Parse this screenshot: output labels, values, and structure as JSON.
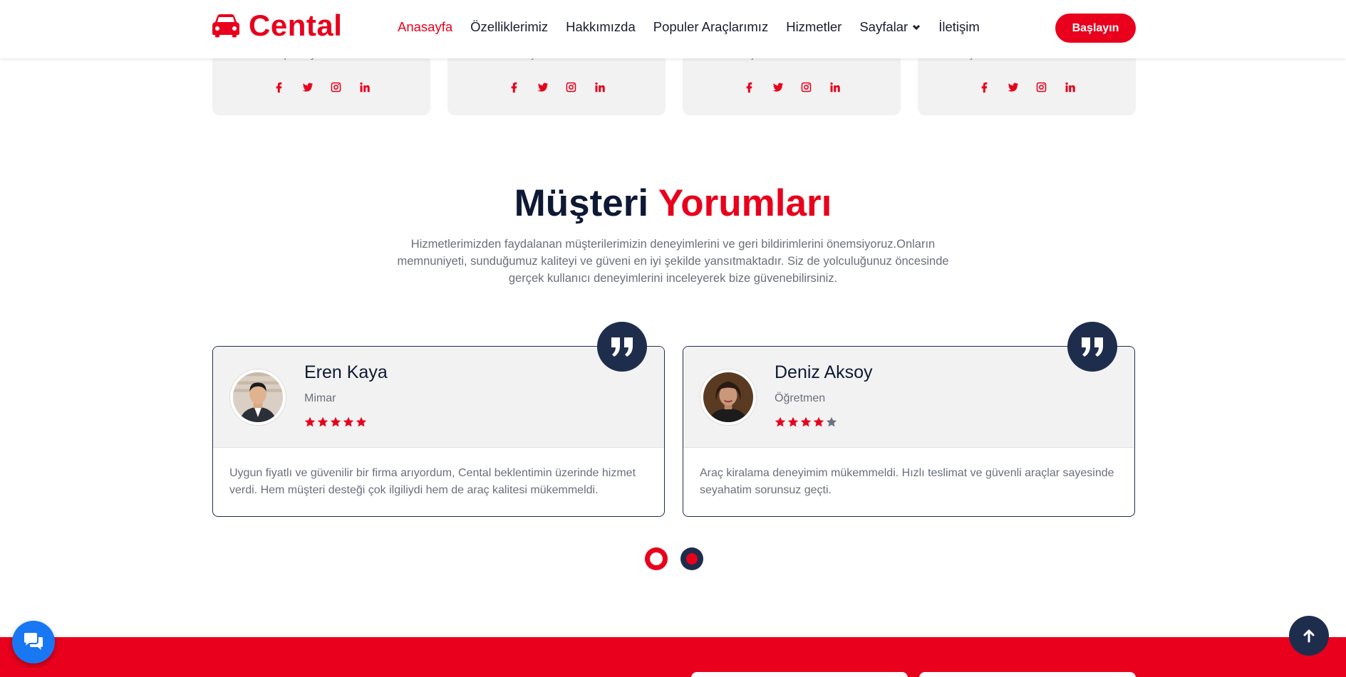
{
  "brand": {
    "name": "Cental",
    "logo_icon": "car-icon"
  },
  "nav": {
    "items": [
      {
        "label": "Anasayfa",
        "active": true
      },
      {
        "label": "Özelliklerimiz"
      },
      {
        "label": "Hakkımızda"
      },
      {
        "label": "Populer Araçlarımız"
      },
      {
        "label": "Hizmetler"
      },
      {
        "label": "Sayfalar",
        "dropdown": true
      },
      {
        "label": "İletişim"
      }
    ],
    "cta_label": "Başlayın"
  },
  "team": [
    {
      "role": "Operasyon Müdürü"
    },
    {
      "role": "Müşteri Temsilcisi"
    },
    {
      "role": "Araç Teslimat Sorumlusu"
    },
    {
      "role": "Araç Bakım & Temizlik Görevlisi"
    }
  ],
  "social_icons": [
    "facebook-icon",
    "twitter-icon",
    "instagram-icon",
    "linkedin-icon"
  ],
  "testimonials_section": {
    "title_part1": "Müşteri",
    "title_part2": "Yorumları",
    "description": "Hizmetlerimizden faydalanan müşterilerimizin deneyimlerini ve geri bildirimlerini önemsiyoruz.Onların memnuniyeti, sunduğumuz kaliteyi ve güveni en iyi şekilde yansıtmaktadır. Siz de yolculuğunuz öncesinde gerçek kullanıcı deneyimlerini inceleyerek bize güvenebilirsiniz."
  },
  "testimonials": [
    {
      "name": "Eren Kaya",
      "job": "Mimar",
      "rating": 5,
      "text": "Uygun fiyatlı ve güvenilir bir firma arıyordum, Cental beklentimin üzerinde hizmet verdi. Hem müşteri desteği çok ilgiliydi hem de araç kalitesi mükemmeldi."
    },
    {
      "name": "Deniz Aksoy",
      "job": "Öğretmen",
      "rating": 4,
      "text": "Araç kiralama deneyimim mükemmeldi. Hızlı teslimat ve güvenli araçlar sayesinde seyahatim sorunsuz geçti."
    }
  ],
  "pagination": {
    "active_index": 0,
    "count": 2
  },
  "colors": {
    "accent": "#e8001c",
    "navy": "#1f2d4d",
    "dark": "#0e1934",
    "chat": "#1877f2"
  }
}
